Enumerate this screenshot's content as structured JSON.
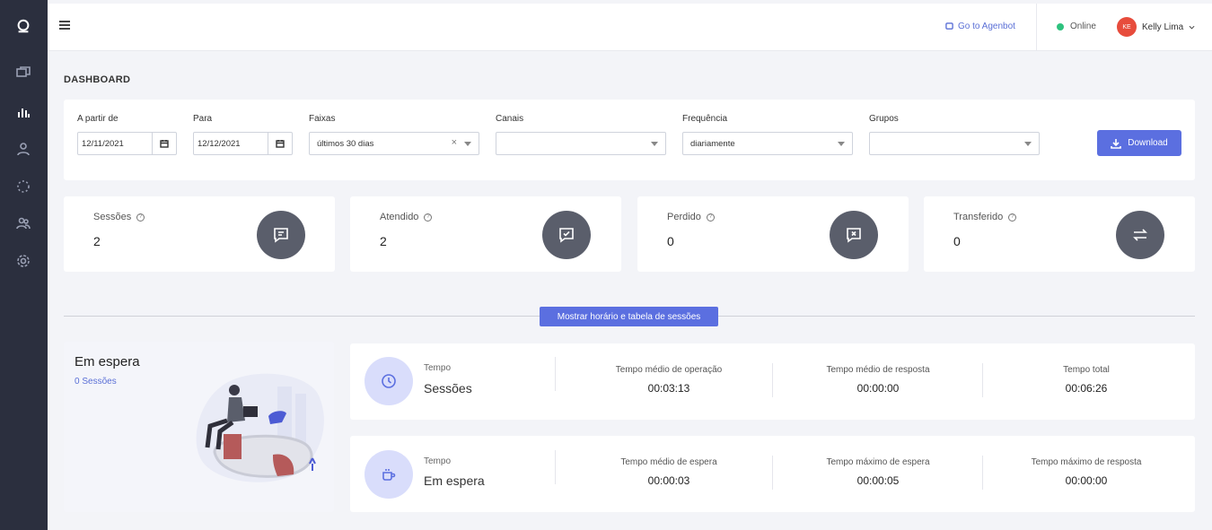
{
  "header": {
    "agenbot_label": "Go to Agenbot",
    "status": "Online",
    "user_initials": "KE",
    "user_name": "Kelly Lima"
  },
  "page_title": "DASHBOARD",
  "filters": {
    "from_label": "A partir de",
    "from_value": "12/11/2021",
    "to_label": "Para",
    "to_value": "12/12/2021",
    "range_label": "Faixas",
    "range_value": "últimos 30 dias",
    "channels_label": "Canais",
    "channels_value": "",
    "frequency_label": "Frequência",
    "frequency_value": "diariamente",
    "groups_label": "Grupos",
    "groups_value": "",
    "download_label": "Download"
  },
  "stats": [
    {
      "label": "Sessões",
      "value": "2"
    },
    {
      "label": "Atendido",
      "value": "2"
    },
    {
      "label": "Perdido",
      "value": "0"
    },
    {
      "label": "Transferido",
      "value": "0"
    }
  ],
  "toggle_button": "Mostrar horário e tabela de sessões",
  "waiting": {
    "title": "Em espera",
    "subtitle": "0 Sessões"
  },
  "time_rows": [
    {
      "small": "Tempo",
      "big": "Sessões",
      "metrics": [
        {
          "label": "Tempo médio de operação",
          "value": "00:03:13"
        },
        {
          "label": "Tempo médio de resposta",
          "value": "00:00:00"
        },
        {
          "label": "Tempo total",
          "value": "00:06:26"
        }
      ]
    },
    {
      "small": "Tempo",
      "big": "Em espera",
      "metrics": [
        {
          "label": "Tempo médio de espera",
          "value": "00:00:03"
        },
        {
          "label": "Tempo máximo de espera",
          "value": "00:00:05"
        },
        {
          "label": "Tempo máximo de resposta",
          "value": "00:00:00"
        }
      ]
    }
  ]
}
